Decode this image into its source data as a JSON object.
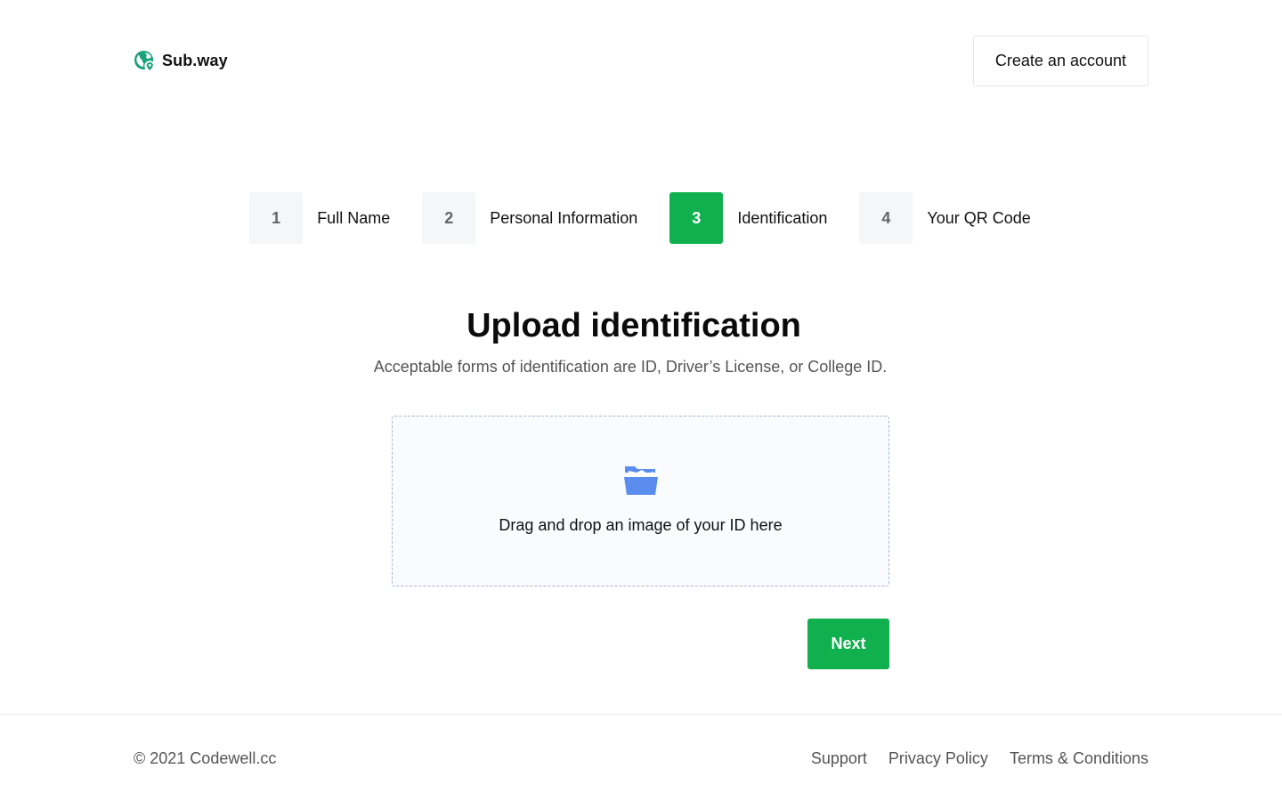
{
  "header": {
    "brand_name": "Sub.way",
    "logo_icon": "globe-location-icon",
    "create_account_label": "Create an account"
  },
  "stepper": {
    "active_step": 3,
    "steps": [
      {
        "number": "1",
        "label": "Full Name"
      },
      {
        "number": "2",
        "label": "Personal Information"
      },
      {
        "number": "3",
        "label": "Identification"
      },
      {
        "number": "4",
        "label": "Your QR Code"
      }
    ]
  },
  "main": {
    "title": "Upload identification",
    "subtitle": "Acceptable forms of identification are ID, Driver’s License, or College ID.",
    "dropzone": {
      "icon": "folder-open-icon",
      "text": "Drag and drop an image of your ID here"
    },
    "next_label": "Next"
  },
  "footer": {
    "copyright": "© 2021 Codewell.cc",
    "links": [
      "Support",
      "Privacy Policy",
      "Terms & Conditions"
    ]
  },
  "colors": {
    "accent": "#11b04f",
    "brand_logo": "#1aa37a",
    "folder_icon": "#5b8def",
    "step_inactive_bg": "#f5f6f8",
    "dropzone_border": "#a9b8cc"
  }
}
